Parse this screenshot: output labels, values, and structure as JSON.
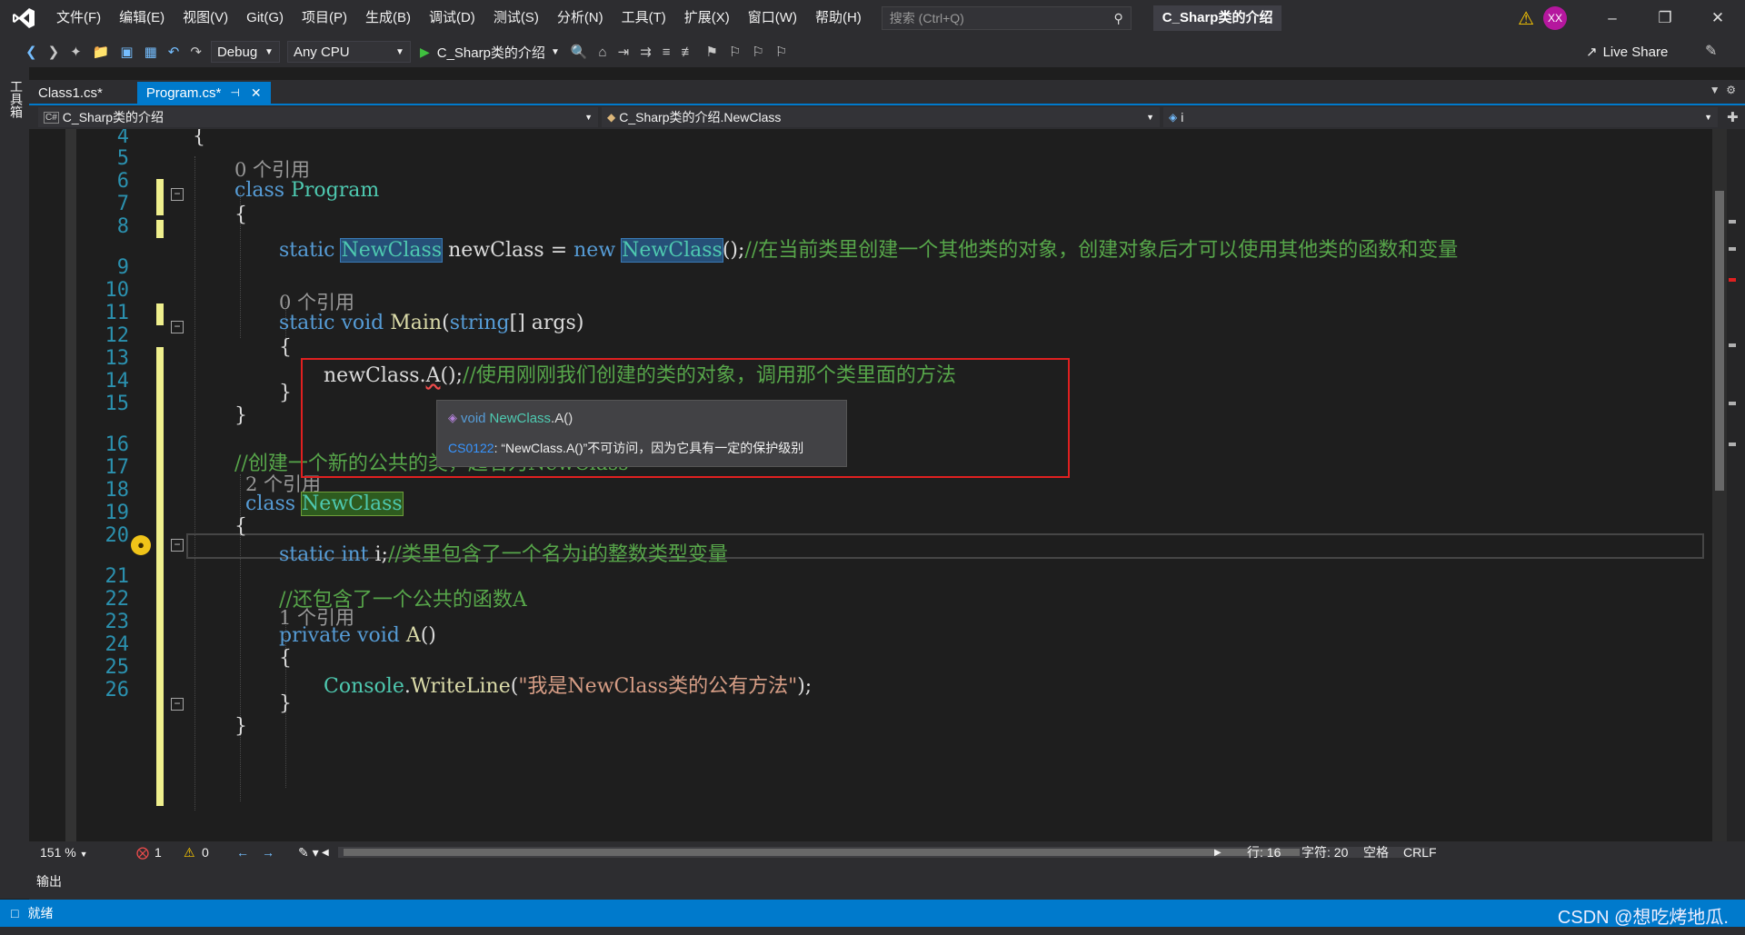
{
  "menubar": {
    "items": [
      "文件(F)",
      "编辑(E)",
      "视图(V)",
      "Git(G)",
      "项目(P)",
      "生成(B)",
      "调试(D)",
      "测试(S)",
      "分析(N)",
      "工具(T)",
      "扩展(X)",
      "窗口(W)",
      "帮助(H)"
    ],
    "search_placeholder": "搜索 (Ctrl+Q)",
    "solution_title": "C_Sharp类的介绍",
    "avatar": "XX"
  },
  "toolbar": {
    "config": "Debug",
    "platform": "Any CPU",
    "run_target": "C_Sharp类的介绍",
    "live_share": "Live Share"
  },
  "sidebar": {
    "toolbox_label": "工具箱"
  },
  "tabs": [
    {
      "label": "Class1.cs*"
    },
    {
      "label": "Program.cs*"
    }
  ],
  "navbar": {
    "project": "C_Sharp类的介绍",
    "type": "C_Sharp类的介绍.NewClass",
    "member": "i",
    "project_icon": "C#"
  },
  "editor": {
    "line_numbers": [
      "4",
      "5",
      "6",
      "7",
      "8",
      "9",
      "10",
      "11",
      "12",
      "13",
      "14",
      "15",
      "16",
      "17",
      "18",
      "19",
      "20",
      "21",
      "22",
      "23",
      "24",
      "25",
      "26"
    ],
    "lens": {
      "program": "0 个引用",
      "main": "0 个引用",
      "newclass": "2 个引用",
      "method_a": "1 个引用"
    },
    "lines": {
      "l4_brace": "{",
      "l5_kw": "class ",
      "l5_type": "Program",
      "l6_brace": "{",
      "l7_static": "static ",
      "l7_type1": "NewClass",
      "l7_mid": " newClass = ",
      "l7_new": "new ",
      "l7_type2": "NewClass",
      "l7_tail": "();",
      "l7_comment": "//在当前类里创建一个其他类的对象，创建对象后才可以使用其他类的函数和变量",
      "l9_kw": "static void ",
      "l9_name": "Main",
      "l9_paren": "(",
      "l9_string": "string",
      "l9_rest": "[] ",
      "l9_args": "args",
      "l9_close": ")",
      "l10_brace": "{",
      "l11_obj": "newClass.",
      "l11_method": "A",
      "l11_tail": "();",
      "l11_comment": "//使用刚刚我们创建的类的对象，调用那个类里面的方法",
      "l12_brace": "}",
      "l13_brace": "}",
      "l15_comment": "//创建一个新的公共的类，起名为NewClass",
      "l16_kw": "class ",
      "l16_type": "NewClass",
      "l17_brace": "{",
      "l18_kw": "static int ",
      "l18_var": "i",
      "l18_semi": ";",
      "l18_comment": "//类里包含了一个名为i的整数类型变量",
      "l20_comment": "//还包含了一个公共的函数A",
      "l21_kw": "private void ",
      "l21_name": "A",
      "l21_paren": "()",
      "l22_brace": "{",
      "l23_type": "Console",
      "l23_dot": ".",
      "l23_method": "WriteLine",
      "l23_open": "(",
      "l23_str": "\"我是NewClass类的公有方法\"",
      "l23_close": ");",
      "l24_brace": "}",
      "l25_brace": "}",
      "l26_brace": "}"
    }
  },
  "tooltip": {
    "void": "void",
    "type": "NewClass",
    "member": ".A()",
    "code": "CS0122",
    "message": ": “NewClass.A()”不可访问，因为它具有一定的保护级别"
  },
  "editor_status": {
    "zoom": "151 %",
    "errors": "1",
    "warnings": "0",
    "line": "行: 16",
    "col": "字符: 20",
    "spacing": "空格",
    "eol": "CRLF"
  },
  "output": {
    "label": "输出"
  },
  "statusbar": {
    "ready": "就绪",
    "watermark": "CSDN @想吃烤地瓜."
  },
  "colors": {
    "accent": "#007acc",
    "keyword": "#569cd6",
    "type": "#4ec9b0",
    "comment": "#57a64a",
    "string": "#d69d85",
    "error_box": "#e02020"
  }
}
